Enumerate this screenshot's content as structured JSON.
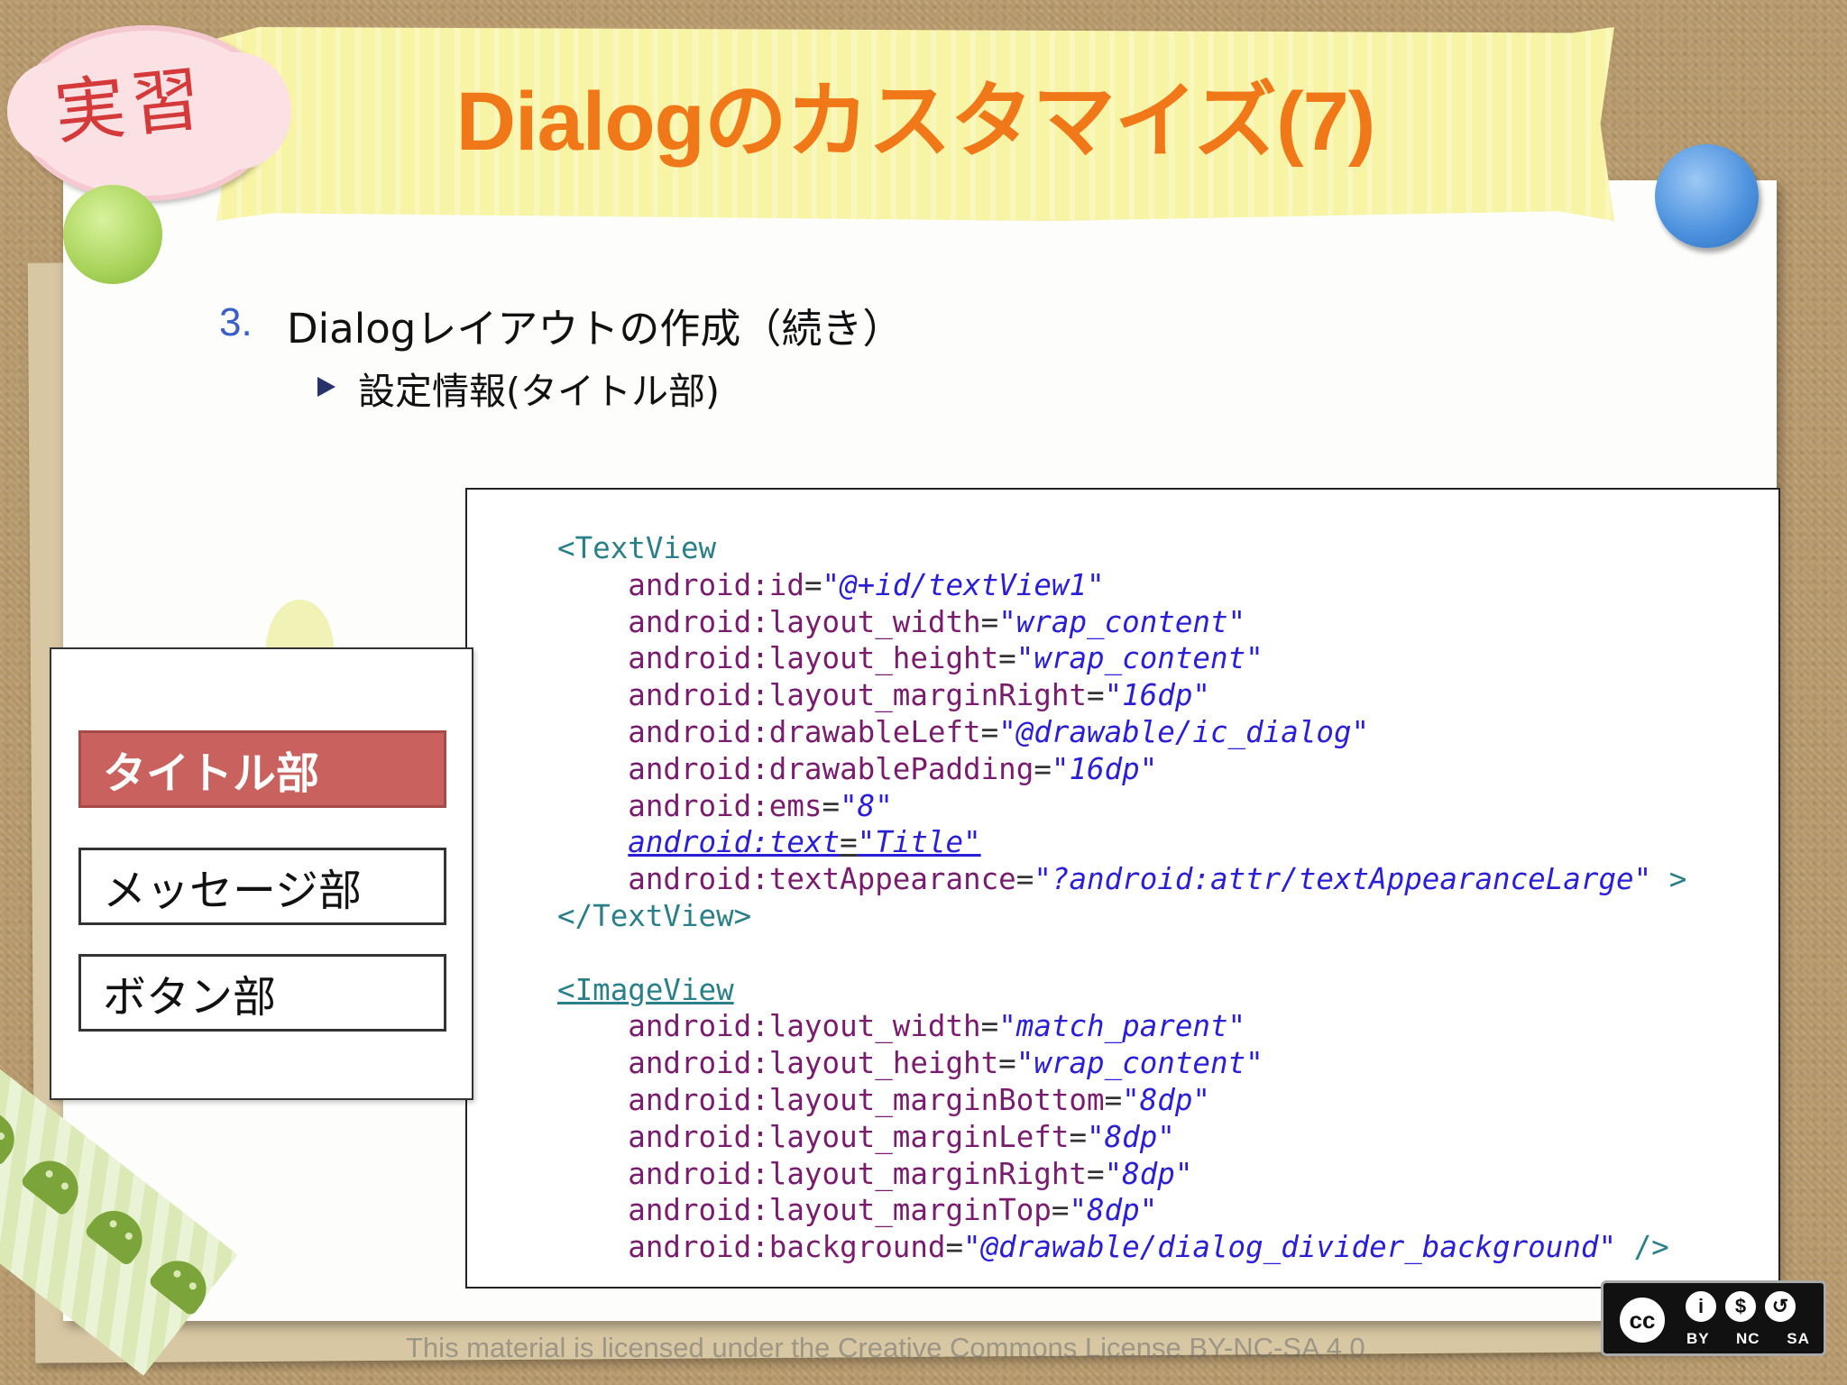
{
  "slide": {
    "badge": "実習",
    "title": "Dialogのカスタマイズ(7)",
    "heading_number": "3.",
    "heading_text": "Dialogレイアウトの作成（続き）",
    "subheading": "設定情報(タイトル部)"
  },
  "code": {
    "lines": [
      [
        {
          "c": "tag",
          "t": "<TextView"
        }
      ],
      [
        {
          "c": "attr",
          "t": "    android:id"
        },
        {
          "c": "eq",
          "t": "="
        },
        {
          "c": "val",
          "t": "\"@+id/textView1\""
        }
      ],
      [
        {
          "c": "attr",
          "t": "    android:layout_width"
        },
        {
          "c": "eq",
          "t": "="
        },
        {
          "c": "val",
          "t": "\"wrap_content\""
        }
      ],
      [
        {
          "c": "attr",
          "t": "    android:layout_height"
        },
        {
          "c": "eq",
          "t": "="
        },
        {
          "c": "val",
          "t": "\"wrap_content\""
        }
      ],
      [
        {
          "c": "attr",
          "t": "    android:layout_marginRight"
        },
        {
          "c": "eq",
          "t": "="
        },
        {
          "c": "val",
          "t": "\"16dp\""
        }
      ],
      [
        {
          "c": "attr",
          "t": "    android:drawableLeft"
        },
        {
          "c": "eq",
          "t": "="
        },
        {
          "c": "val",
          "t": "\"@drawable/ic_dialog\""
        }
      ],
      [
        {
          "c": "attr",
          "t": "    android:drawablePadding"
        },
        {
          "c": "eq",
          "t": "="
        },
        {
          "c": "val",
          "t": "\"16dp\""
        }
      ],
      [
        {
          "c": "attr",
          "t": "    android:ems"
        },
        {
          "c": "eq",
          "t": "="
        },
        {
          "c": "val",
          "t": "\"8\""
        }
      ],
      [
        {
          "c": "attr",
          "t": "    "
        },
        {
          "c": "attr u val",
          "t": "android:text"
        },
        {
          "c": "eq u",
          "t": "="
        },
        {
          "c": "val u",
          "t": "\"Title\""
        }
      ],
      [
        {
          "c": "attr",
          "t": "    android:textAppearance"
        },
        {
          "c": "eq",
          "t": "="
        },
        {
          "c": "val",
          "t": "\"?android:attr/textAppearanceLarge\""
        },
        {
          "c": "tag",
          "t": " >"
        }
      ],
      [
        {
          "c": "tag",
          "t": "</TextView>"
        }
      ],
      [
        {
          "c": "tag",
          "t": ""
        }
      ],
      [
        {
          "c": "tag u",
          "t": "<ImageView"
        }
      ],
      [
        {
          "c": "attr",
          "t": "    android:layout_width"
        },
        {
          "c": "eq",
          "t": "="
        },
        {
          "c": "val",
          "t": "\"match_parent\""
        }
      ],
      [
        {
          "c": "attr",
          "t": "    android:layout_height"
        },
        {
          "c": "eq",
          "t": "="
        },
        {
          "c": "val",
          "t": "\"wrap_content\""
        }
      ],
      [
        {
          "c": "attr",
          "t": "    android:layout_marginBottom"
        },
        {
          "c": "eq",
          "t": "="
        },
        {
          "c": "val",
          "t": "\"8dp\""
        }
      ],
      [
        {
          "c": "attr",
          "t": "    android:layout_marginLeft"
        },
        {
          "c": "eq",
          "t": "="
        },
        {
          "c": "val",
          "t": "\"8dp\""
        }
      ],
      [
        {
          "c": "attr",
          "t": "    android:layout_marginRight"
        },
        {
          "c": "eq",
          "t": "="
        },
        {
          "c": "val",
          "t": "\"8dp\""
        }
      ],
      [
        {
          "c": "attr",
          "t": "    android:layout_marginTop"
        },
        {
          "c": "eq",
          "t": "="
        },
        {
          "c": "val",
          "t": "\"8dp\""
        }
      ],
      [
        {
          "c": "attr",
          "t": "    android:background"
        },
        {
          "c": "eq",
          "t": "="
        },
        {
          "c": "val",
          "t": "\"@drawable/dialog_divider_background\""
        },
        {
          "c": "tag",
          "t": " />"
        }
      ]
    ]
  },
  "diagram": {
    "title_part": "タイトル部",
    "message_part": "メッセージ部",
    "button_part": "ボタン部"
  },
  "footer": {
    "license_text": "This material is licensed under the Creative Commons License BY-NC-SA 4.0.",
    "cc_mark": "cc",
    "cc_labels": "BY NC SA"
  },
  "colors": {
    "title": "#f07818",
    "heading_number": "#3a5dc8",
    "highlight_part": "#c9615e"
  }
}
